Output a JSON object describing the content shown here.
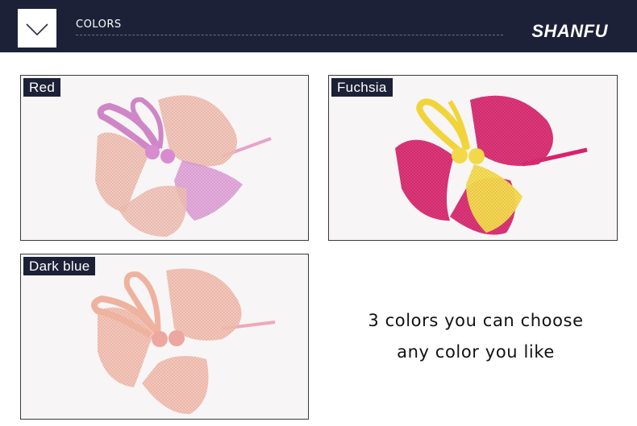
{
  "header": {
    "section_title": "COLORS",
    "brand": "SHANFU",
    "menu_icon": "chevron-down-icon"
  },
  "products": [
    {
      "label": "Red"
    },
    {
      "label": "Fuchsia"
    },
    {
      "label": "Dark blue"
    }
  ],
  "note": {
    "line1": "3 colors you can choose",
    "line2": "any color you like"
  },
  "colors": {
    "header_bg": "#1c2137",
    "tag_bg": "#1c2137",
    "red_variant_mesh": "#eab2a6",
    "red_variant_loop": "#d690cc",
    "fuchsia_variant_mesh": "#d8226e",
    "fuchsia_variant_accent": "#f5dc45",
    "darkblue_variant_mesh": "#f0b6a6"
  }
}
